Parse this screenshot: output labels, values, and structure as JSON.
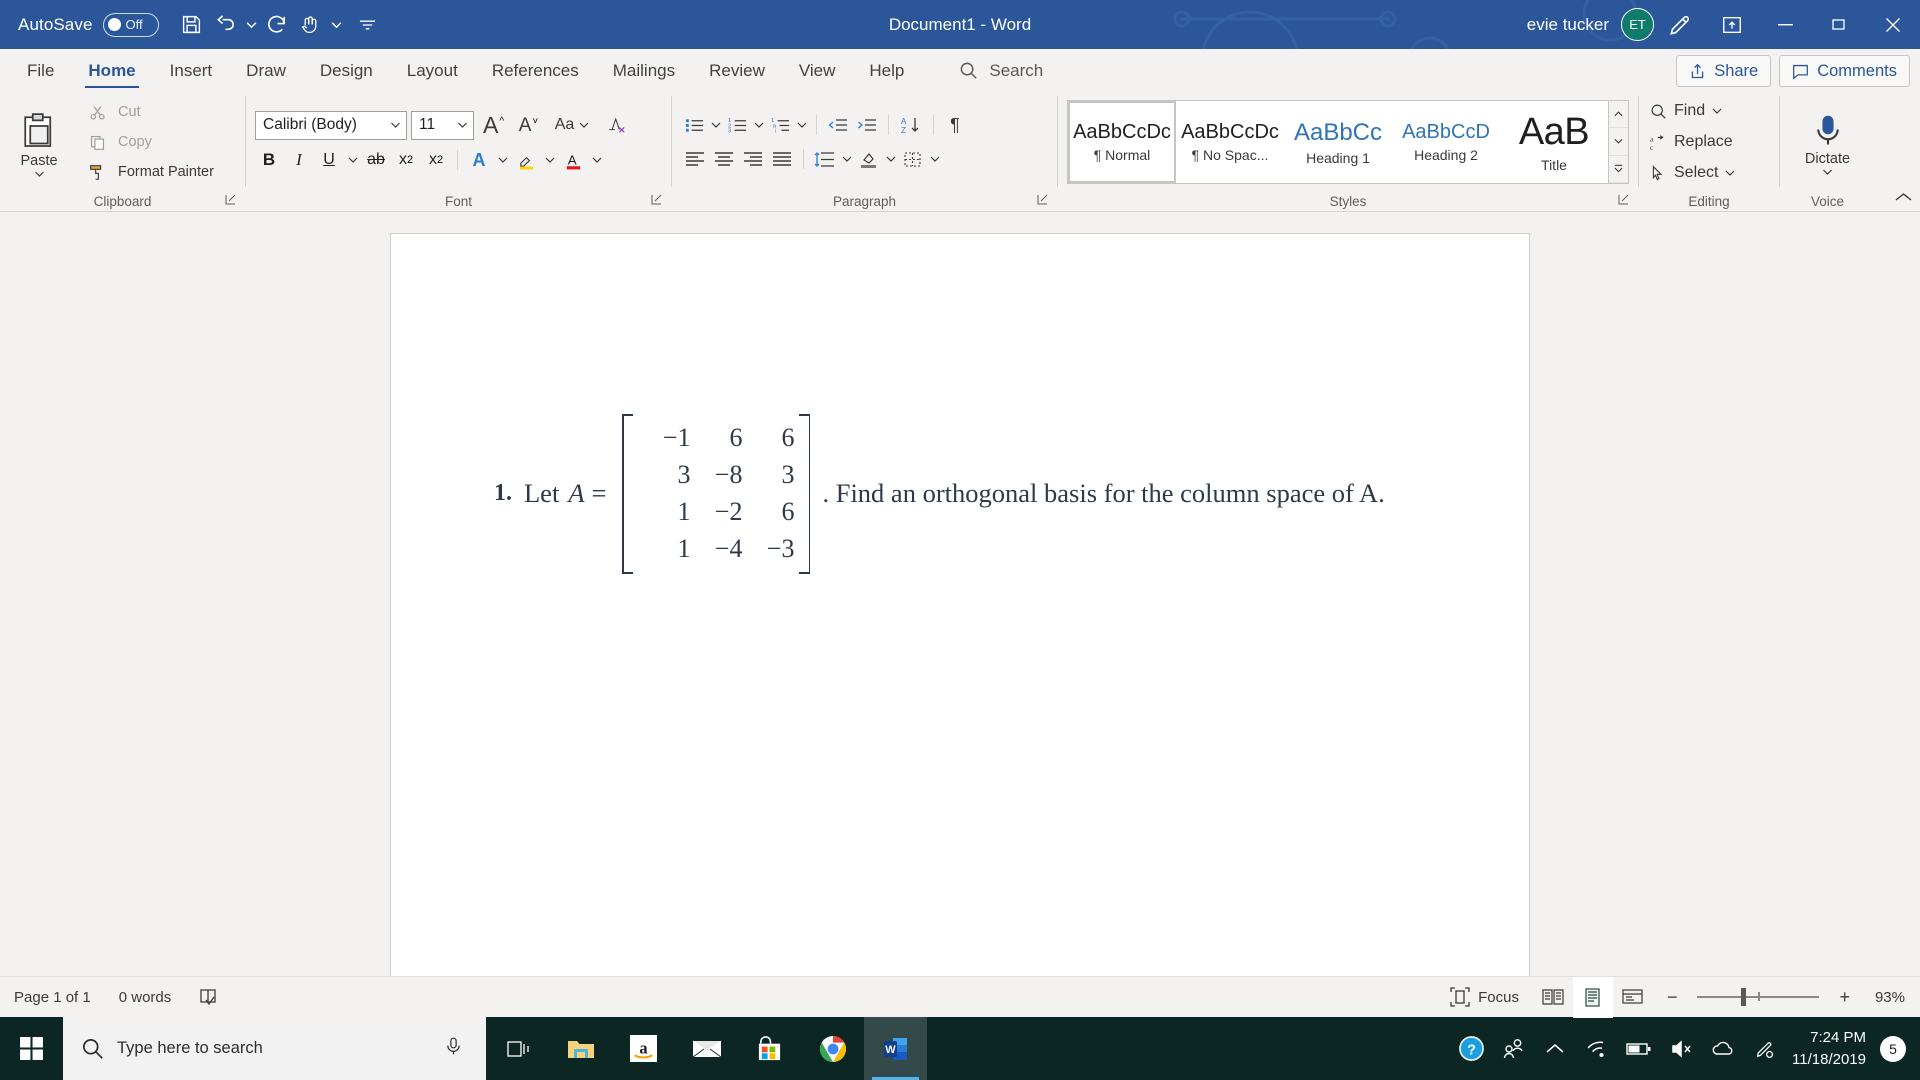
{
  "titlebar": {
    "autosave_label": "AutoSave",
    "autosave_state": "Off",
    "document_title": "Document1  -  Word",
    "user_name": "evie tucker",
    "avatar_initials": "ET",
    "qat": [
      {
        "name": "save-icon",
        "tooltip": "Save"
      },
      {
        "name": "undo-icon",
        "tooltip": "Undo"
      },
      {
        "name": "redo-icon",
        "tooltip": "Redo"
      },
      {
        "name": "touch-mode-icon",
        "tooltip": "Touch/Mouse Mode"
      },
      {
        "name": "customize-qat-icon",
        "tooltip": "Customize Quick Access Toolbar"
      }
    ],
    "window_controls": [
      "minimize",
      "restore",
      "close"
    ],
    "accent_color": "#2b579a"
  },
  "ribbon_tabs": {
    "items": [
      {
        "label": "File",
        "active": false
      },
      {
        "label": "Home",
        "active": true
      },
      {
        "label": "Insert",
        "active": false
      },
      {
        "label": "Draw",
        "active": false
      },
      {
        "label": "Design",
        "active": false
      },
      {
        "label": "Layout",
        "active": false
      },
      {
        "label": "References",
        "active": false
      },
      {
        "label": "Mailings",
        "active": false
      },
      {
        "label": "Review",
        "active": false
      },
      {
        "label": "View",
        "active": false
      },
      {
        "label": "Help",
        "active": false
      }
    ],
    "search_placeholder": "Search",
    "share_label": "Share",
    "comments_label": "Comments"
  },
  "ribbon": {
    "clipboard": {
      "group_label": "Clipboard",
      "paste_label": "Paste",
      "cut_label": "Cut",
      "copy_label": "Copy",
      "format_painter_label": "Format Painter"
    },
    "font": {
      "group_label": "Font",
      "font_family": "Calibri (Body)",
      "font_size": "11",
      "buttons": [
        "grow-font",
        "shrink-font",
        "change-case",
        "clear-formatting",
        "bold",
        "italic",
        "underline",
        "strikethrough",
        "subscript",
        "superscript",
        "text-effects",
        "text-highlight",
        "font-color"
      ]
    },
    "paragraph": {
      "group_label": "Paragraph",
      "buttons": [
        "bullets",
        "numbering",
        "multilevel-list",
        "decrease-indent",
        "increase-indent",
        "sort",
        "show-formatting-marks",
        "align-left",
        "align-center",
        "align-right",
        "justify",
        "line-spacing",
        "shading",
        "borders"
      ]
    },
    "styles": {
      "group_label": "Styles",
      "items": [
        {
          "preview": "AaBbCcDc",
          "name": "¶ Normal",
          "selected": true,
          "variant": "normal"
        },
        {
          "preview": "AaBbCcDc",
          "name": "¶ No Spac...",
          "selected": false,
          "variant": "normal"
        },
        {
          "preview": "AaBbCc",
          "name": "Heading 1",
          "selected": false,
          "variant": "h1"
        },
        {
          "preview": "AaBbCcD",
          "name": "Heading 2",
          "selected": false,
          "variant": "h2"
        },
        {
          "preview": "AaB",
          "name": "Title",
          "selected": false,
          "variant": "title"
        }
      ]
    },
    "editing": {
      "group_label": "Editing",
      "find_label": "Find",
      "replace_label": "Replace",
      "select_label": "Select"
    },
    "voice": {
      "group_label": "Voice",
      "dictate_label": "Dictate"
    }
  },
  "document": {
    "problem_number": "1.",
    "lead_text": "Let",
    "variable": "A",
    "equals": "=",
    "matrix": [
      [
        "−1",
        "6",
        "6"
      ],
      [
        "3",
        "−8",
        "3"
      ],
      [
        "1",
        "−2",
        "6"
      ],
      [
        "1",
        "−4",
        "−3"
      ]
    ],
    "trailing_text": ". Find an orthogonal basis for the column space of A."
  },
  "statusbar": {
    "page_label": "Page 1 of 1",
    "word_count": "0 words",
    "proofing_icon": "proofing-icon",
    "focus_label": "Focus",
    "views": [
      {
        "name": "read-mode-view",
        "active": false
      },
      {
        "name": "print-layout-view",
        "active": true
      },
      {
        "name": "web-layout-view",
        "active": false
      }
    ],
    "zoom_out": "−",
    "zoom_in": "+",
    "zoom_percent": "93%"
  },
  "taskbar": {
    "start_icon": "windows-start-icon",
    "search_placeholder": "Type here to search",
    "mic_icon": "microphone-icon",
    "task_view_icon": "task-view-icon",
    "apps": [
      {
        "name": "file-explorer-icon",
        "active": false
      },
      {
        "name": "amazon-icon",
        "active": false
      },
      {
        "name": "mail-icon",
        "active": false
      },
      {
        "name": "microsoft-store-icon",
        "active": false
      },
      {
        "name": "google-chrome-icon",
        "active": false
      },
      {
        "name": "microsoft-word-icon",
        "active": true
      }
    ],
    "tray": [
      {
        "name": "help-icon"
      },
      {
        "name": "people-icon"
      },
      {
        "name": "show-hidden-icons-icon"
      },
      {
        "name": "wifi-icon"
      },
      {
        "name": "battery-icon"
      },
      {
        "name": "volume-icon"
      },
      {
        "name": "onedrive-icon"
      },
      {
        "name": "pen-menu-icon"
      }
    ],
    "time": "7:24 PM",
    "date": "11/18/2019",
    "notification_count": "5"
  }
}
